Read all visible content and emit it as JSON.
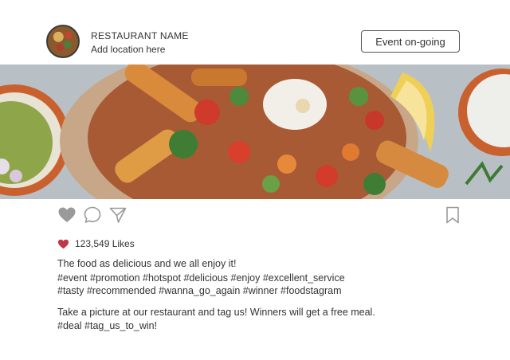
{
  "header": {
    "restaurant_name": "RESTAURANT NAME",
    "location": "Add location here",
    "event_button_label": "Event on-going"
  },
  "photo": {
    "subject": "food dish photo"
  },
  "actions": {
    "icons": [
      "heart-icon",
      "comment-icon",
      "share-icon",
      "bookmark-icon"
    ]
  },
  "likes": {
    "count_label": "123,549 Likes",
    "heart_color": "#c0364a"
  },
  "caption": {
    "line1": "The food as delicious and we all enjoy it!",
    "line2": "#event #promotion #hotspot #delicious #enjoy #excellent_service",
    "line3": "#tasty #recommended #wanna_go_again #winner #foodstagram",
    "line4": "Take a picture at our restaurant and tag us! Winners will get a free meal.",
    "line5": "#deal #tag_us_to_win!"
  }
}
